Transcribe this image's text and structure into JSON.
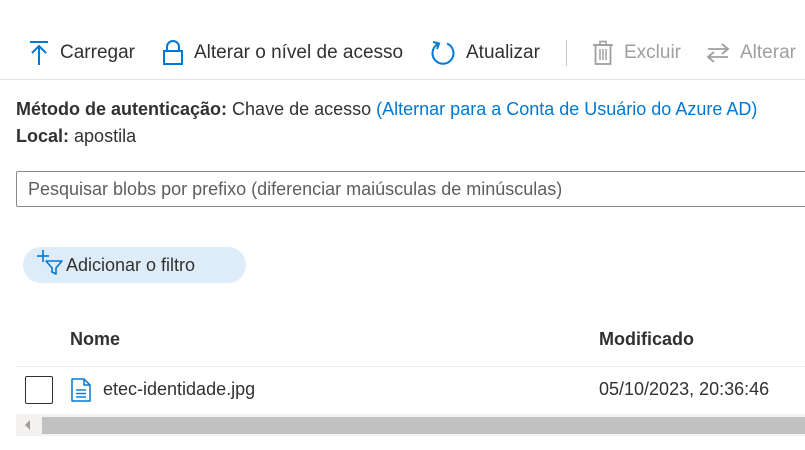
{
  "toolbar": {
    "upload_label": "Carregar",
    "access_level_label": "Alterar o nível de acesso",
    "refresh_label": "Atualizar",
    "delete_label": "Excluir",
    "change_label": "Alterar"
  },
  "info": {
    "auth_method_label": "Método de autenticação:",
    "auth_method_value": "Chave de acesso",
    "auth_method_link": "(Alternar para a Conta de Usuário do Azure AD)",
    "location_label": "Local:",
    "location_value": "apostila"
  },
  "search": {
    "placeholder": "Pesquisar blobs por prefixo (diferenciar maiúsculas de minúsculas)",
    "value": ""
  },
  "filter": {
    "add_filter_label": "Adicionar o filtro"
  },
  "table": {
    "columns": [
      "Nome",
      "Modificado"
    ],
    "rows": [
      {
        "name": "etec-identidade.jpg",
        "modified": "05/10/2023, 20:36:46",
        "icon": "document-icon"
      }
    ]
  },
  "colors": {
    "accent": "#0078d4",
    "filter_pill_bg": "#deecf9",
    "disabled_text": "#a19f9d"
  }
}
